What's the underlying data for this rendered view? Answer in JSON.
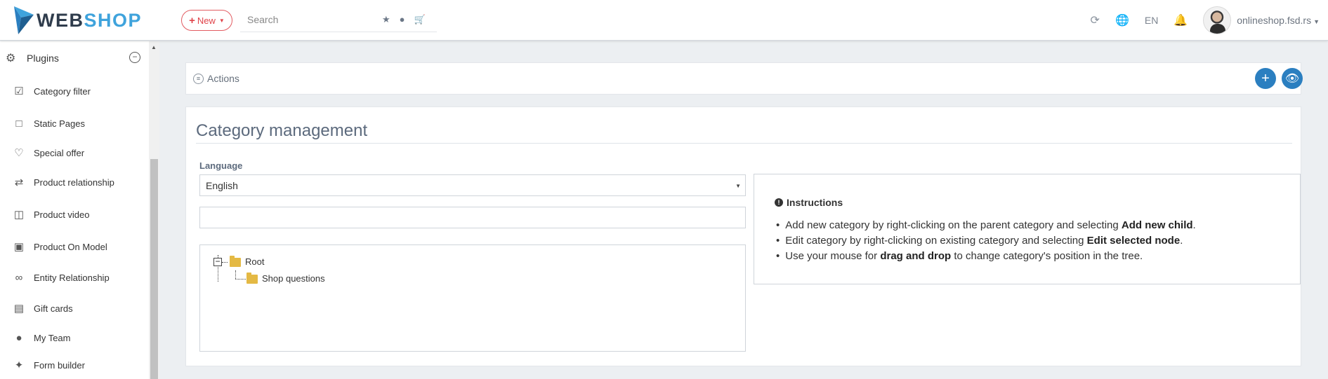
{
  "topbar": {
    "logo": {
      "word1": "WEB",
      "word2": "SHOP"
    },
    "new_button": {
      "icon": "plus-icon",
      "label": "New",
      "caret": "chevron-down-icon"
    },
    "search": {
      "placeholder": "Search",
      "icons": [
        "star-icon",
        "user-icon",
        "cart-icon"
      ]
    },
    "right": {
      "icons": [
        "refresh-icon",
        "globe-icon"
      ],
      "language": "EN",
      "notification_icon": "bell-icon",
      "account": "onlineshop.fsd.rs"
    }
  },
  "sidebar": {
    "header": {
      "icon": "plugins-icon",
      "label": "Plugins",
      "collapse_icon": "minus-circle-icon"
    },
    "items": [
      {
        "icon": "checkbox-icon",
        "label": "Category filter"
      },
      {
        "icon": "bookmark-icon",
        "label": "Static Pages"
      },
      {
        "icon": "heart-icon",
        "label": "Special offer"
      },
      {
        "icon": "shuffle-icon",
        "label": "Product relationship"
      },
      {
        "icon": "video-icon",
        "label": "Product video"
      },
      {
        "icon": "image-icon",
        "label": "Product On Model"
      },
      {
        "icon": "link-icon",
        "label": "Entity Relationship"
      },
      {
        "icon": "gift-icon",
        "label": "Gift cards"
      },
      {
        "icon": "team-icon",
        "label": "My Team"
      },
      {
        "icon": "tools-icon",
        "label": "Form builder"
      }
    ]
  },
  "actions": {
    "label": "Actions",
    "add_icon": "plus-icon",
    "view_icon": "eye-icon"
  },
  "main": {
    "title": "Category management",
    "language_label": "Language",
    "language_value": "English",
    "filter_value": "",
    "tree": {
      "root": "Root",
      "children": [
        "Shop questions"
      ]
    },
    "instructions": {
      "title": "Instructions",
      "items": [
        {
          "pre": "Add new category by right-clicking on the parent category and selecting ",
          "bold": "Add new child",
          "post": "."
        },
        {
          "pre": "Edit category by right-clicking on existing category and selecting ",
          "bold": "Edit selected node",
          "post": "."
        },
        {
          "pre": "Use your mouse for ",
          "bold": "drag and drop",
          "post": " to change category's position in the tree."
        }
      ]
    }
  },
  "colors": {
    "accent": "#2b7fc0",
    "new_button": "#e0434a",
    "brand_dark": "#2f3c4c",
    "brand_light": "#3fa3dc",
    "title": "#5c6a7d",
    "folder": "#e4b944"
  }
}
